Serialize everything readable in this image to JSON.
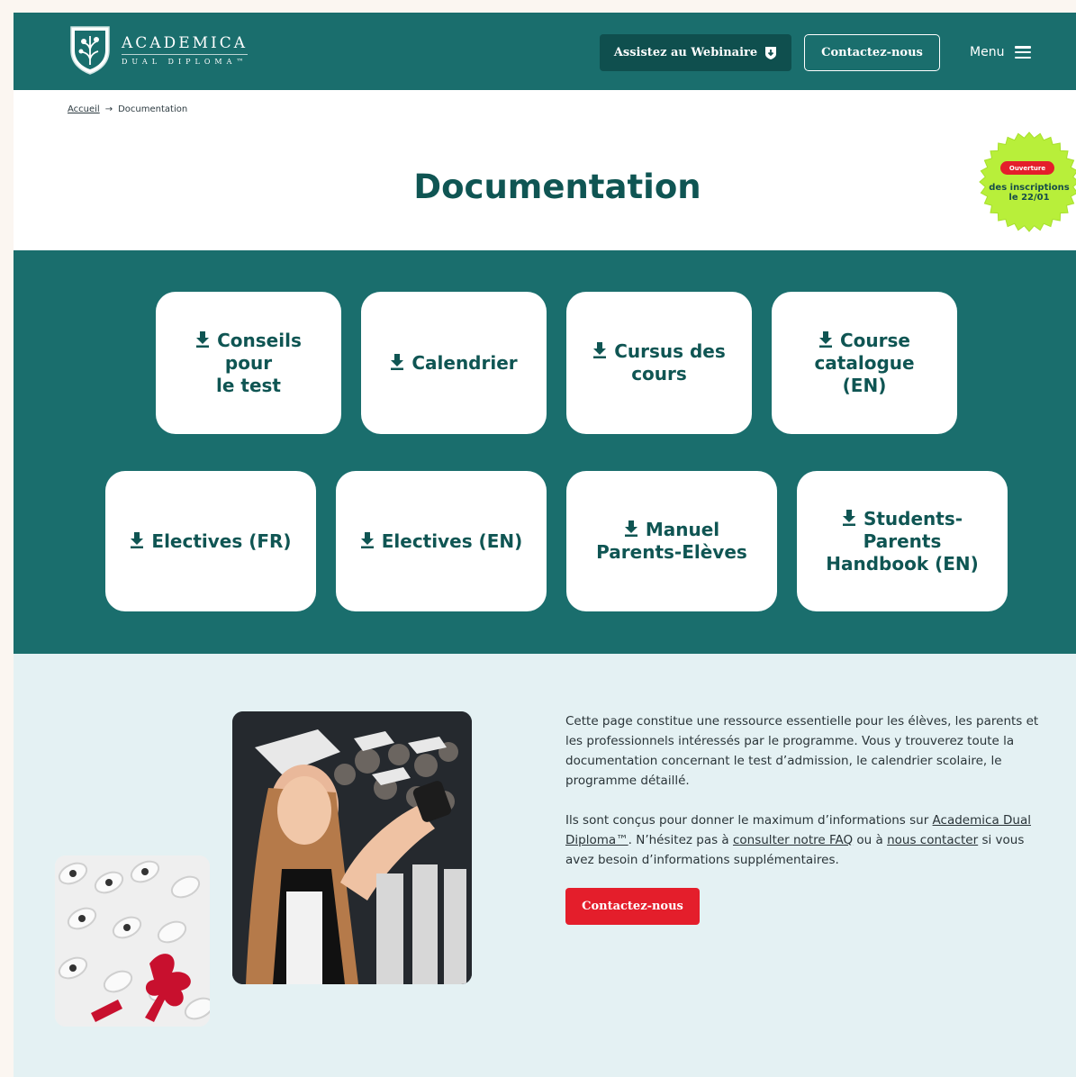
{
  "header": {
    "logo_main": "ACADEMICA",
    "logo_sub": "DUAL DIPLOMA™",
    "webinar_label": "Assistez au Webinaire",
    "contact_label": "Contactez-nous",
    "menu_label": "Menu"
  },
  "breadcrumb": {
    "home": "Accueil",
    "separator": "→",
    "current": "Documentation"
  },
  "page_title": "Documentation",
  "badge": {
    "pill": "Ouverture",
    "line1": "des inscriptions",
    "line2": "le 22/01"
  },
  "documents": [
    {
      "label": "Conseils\npour\nle test"
    },
    {
      "label": "Calendrier"
    },
    {
      "label": "Cursus des\ncours"
    },
    {
      "label": "Course\ncatalogue\n(EN)"
    },
    {
      "label": "Electives (FR)"
    },
    {
      "label": "Electives (EN)"
    },
    {
      "label": "Manuel\nParents-Elèves"
    },
    {
      "label": "Students-\nParents\nHandbook (EN)"
    }
  ],
  "info": {
    "paragraph1": "Cette page constitue une ressource essentielle pour les élèves, les parents et les professionnels intéressés par le programme. Vous y trouverez toute la documentation concernant le test d’admission, le calendrier scolaire, le programme détaillé.",
    "p2_part1": "Ils sont conçus pour donner le maximum d’informations sur ",
    "p2_link1": "Academica Dual Diploma™",
    "p2_part2": ". N’hésitez pas à ",
    "p2_link2": "consulter notre FAQ",
    "p2_part3": " ou à ",
    "p2_link3": "nous contacter",
    "p2_part4": " si vous avez besoin d’informations supplémentaires.",
    "contact_label": "Contactez-nous"
  },
  "colors": {
    "teal": "#1a6e6d",
    "dark_teal": "#0f5553",
    "red": "#e41e2b",
    "light_blue": "#e4f1f3",
    "badge_green": "#b8ef3a"
  }
}
